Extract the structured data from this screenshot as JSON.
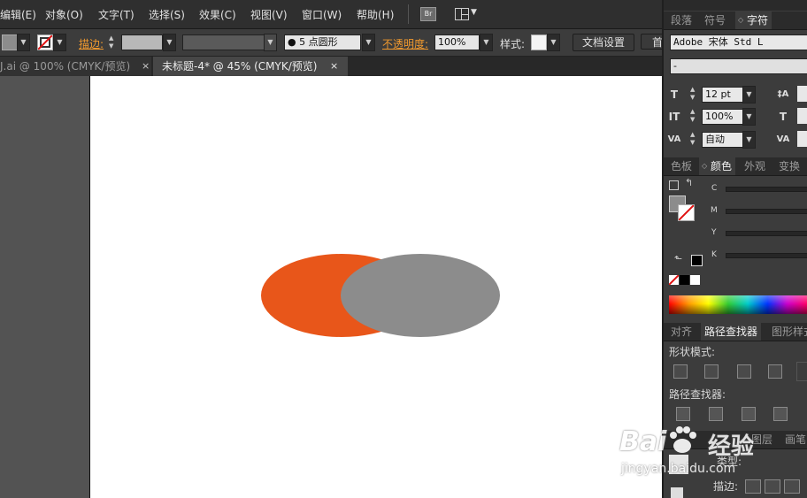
{
  "menu": {
    "items": [
      "编辑(E)",
      "对象(O)",
      "文字(T)",
      "选择(S)",
      "效果(C)",
      "视图(V)",
      "窗口(W)",
      "帮助(H)"
    ],
    "bridge_label": "Br"
  },
  "control": {
    "stroke_label": "描边:",
    "brush_value": "● 5 点圆形",
    "opacity_label": "不透明度:",
    "opacity_value": "100%",
    "style_label": "样式:",
    "doc_settings_label": "文档设置",
    "first_char": "首"
  },
  "tabs": [
    {
      "label": "J.ai @ 100% (CMYK/预览)"
    },
    {
      "label": "未标题-4* @ 45% (CMYK/预览)"
    }
  ],
  "tab_close_glyph": "×",
  "artwork": {
    "left_fill": "#E8561A",
    "right_fill": "#8C8C8C"
  },
  "char_panel": {
    "tabs": [
      "段落",
      "符号",
      "字符"
    ],
    "font_family": "Adobe 宋体 Std L",
    "font_style": "-",
    "size_value": "12 pt",
    "scale_value": "100%",
    "tracking_value": "自动"
  },
  "color_panel": {
    "tabs": [
      "色板",
      "颜色",
      "外观",
      "变换"
    ],
    "channels": [
      "C",
      "M",
      "Y",
      "K"
    ]
  },
  "pathfinder": {
    "tabs": [
      "对齐",
      "路径查找器",
      "图形样式"
    ],
    "shape_modes_label": "形状模式:",
    "pathfinders_label": "路径查找器:"
  },
  "bottom_panel": {
    "tabs": [
      "图层",
      "画笔"
    ],
    "type_label": "类型:",
    "stroke_label": "描边:"
  },
  "watermark": {
    "brand": "Bai",
    "brand2": "du",
    "site": "经验",
    "url": "jingyan.baidu.com"
  }
}
